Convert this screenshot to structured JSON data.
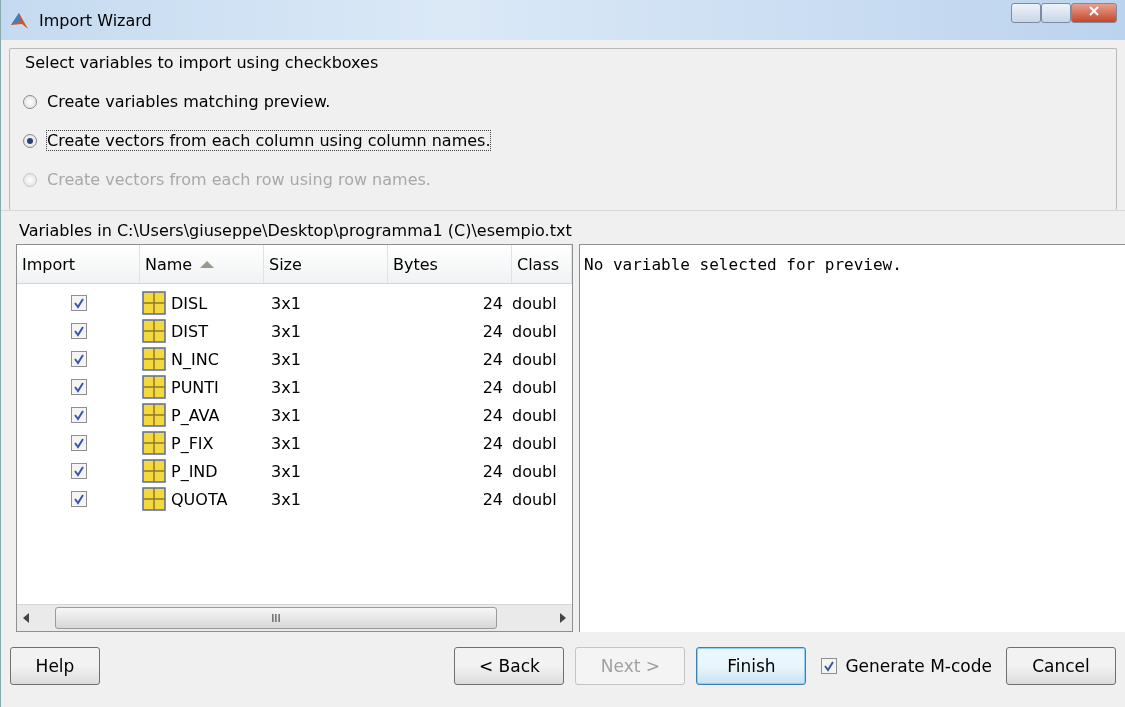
{
  "window": {
    "title": "Import Wizard"
  },
  "options": {
    "title": "Select variables to import using checkboxes",
    "radios": [
      {
        "label": "Create variables matching preview.",
        "selected": false,
        "disabled": false
      },
      {
        "label": "Create vectors from each column using column names.",
        "selected": true,
        "disabled": false
      },
      {
        "label": "Create vectors from each row using row names.",
        "selected": false,
        "disabled": true
      }
    ]
  },
  "variables_label": "Variables in C:\\Users\\giuseppe\\Desktop\\programma1 (C)\\esempio.txt",
  "table": {
    "columns": [
      {
        "label": "Import",
        "sorted": false
      },
      {
        "label": "Name",
        "sorted": true
      },
      {
        "label": "Size",
        "sorted": false
      },
      {
        "label": "Bytes",
        "sorted": false
      },
      {
        "label": "Class",
        "sorted": false
      }
    ],
    "rows": [
      {
        "checked": true,
        "name": "DISL",
        "size": "3x1",
        "bytes": "24",
        "class": "doubl"
      },
      {
        "checked": true,
        "name": "DIST",
        "size": "3x1",
        "bytes": "24",
        "class": "doubl"
      },
      {
        "checked": true,
        "name": "N_INC",
        "size": "3x1",
        "bytes": "24",
        "class": "doubl"
      },
      {
        "checked": true,
        "name": "PUNTI",
        "size": "3x1",
        "bytes": "24",
        "class": "doubl"
      },
      {
        "checked": true,
        "name": "P_AVA",
        "size": "3x1",
        "bytes": "24",
        "class": "doubl"
      },
      {
        "checked": true,
        "name": "P_FIX",
        "size": "3x1",
        "bytes": "24",
        "class": "doubl"
      },
      {
        "checked": true,
        "name": "P_IND",
        "size": "3x1",
        "bytes": "24",
        "class": "doubl"
      },
      {
        "checked": true,
        "name": "QUOTA",
        "size": "3x1",
        "bytes": "24",
        "class": "doubl"
      }
    ],
    "scrollbar_grip": "III"
  },
  "preview": {
    "text": "No variable selected for preview."
  },
  "footer": {
    "help": {
      "label": "Help",
      "disabled": false
    },
    "buttons": [
      {
        "label": "< Back",
        "disabled": false,
        "default": false
      },
      {
        "label": "Next >",
        "disabled": true,
        "default": false
      },
      {
        "label": "Finish",
        "disabled": false,
        "default": true
      }
    ],
    "generate_mcode": {
      "label": "Generate M-code",
      "checked": true
    },
    "cancel": {
      "label": "Cancel",
      "disabled": false
    }
  }
}
